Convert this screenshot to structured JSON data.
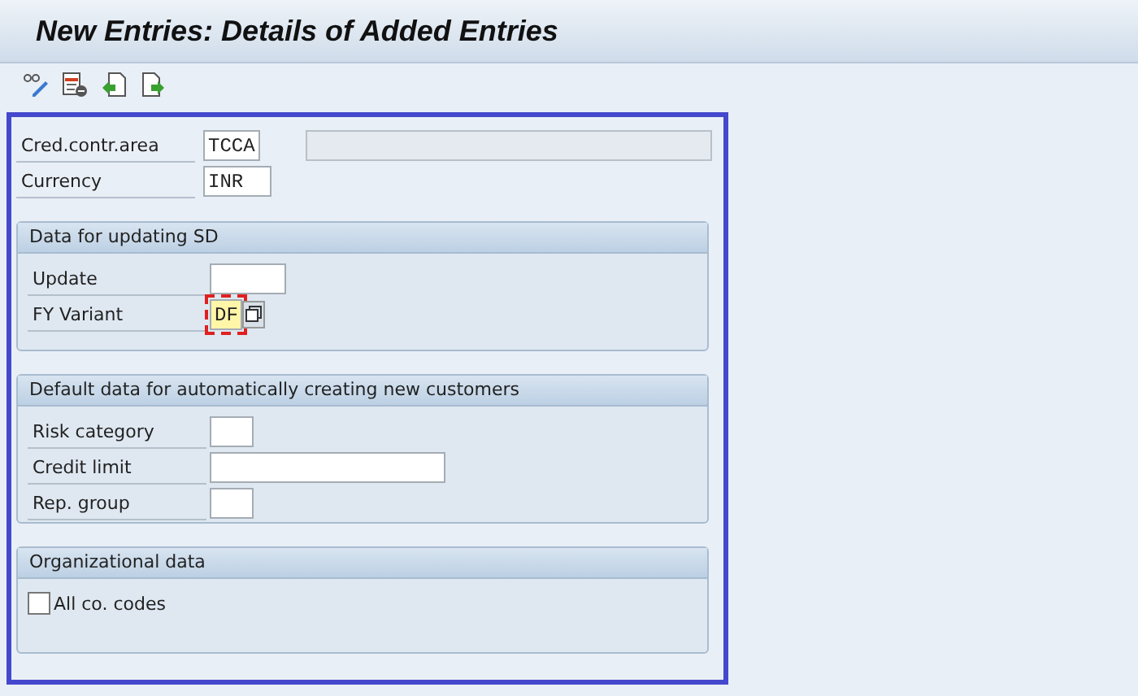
{
  "window": {
    "title": "New Entries: Details of Added Entries"
  },
  "header_fields": [
    {
      "label": "Cred.contr.area",
      "value": "TCCA",
      "description_disabled": true
    },
    {
      "label": "Currency",
      "value": "INR"
    }
  ],
  "groups": [
    {
      "title": "Data for updating SD",
      "fields": [
        {
          "kind": "input",
          "label": "Update",
          "focused": false
        },
        {
          "kind": "input",
          "label": "FY Variant",
          "value": "DF",
          "focused": true,
          "value_help": true
        }
      ]
    },
    {
      "title": "Default data for automatically creating new customers",
      "fields": [
        {
          "kind": "input",
          "label": "Risk category",
          "focused": false
        },
        {
          "kind": "input",
          "label": "Credit limit",
          "focused": false
        },
        {
          "kind": "input",
          "label": "Rep. group",
          "focused": false
        }
      ]
    },
    {
      "title": "Organizational data",
      "fields": [
        {
          "kind": "checkbox",
          "label": "All co. codes",
          "checked": false
        }
      ]
    }
  ]
}
